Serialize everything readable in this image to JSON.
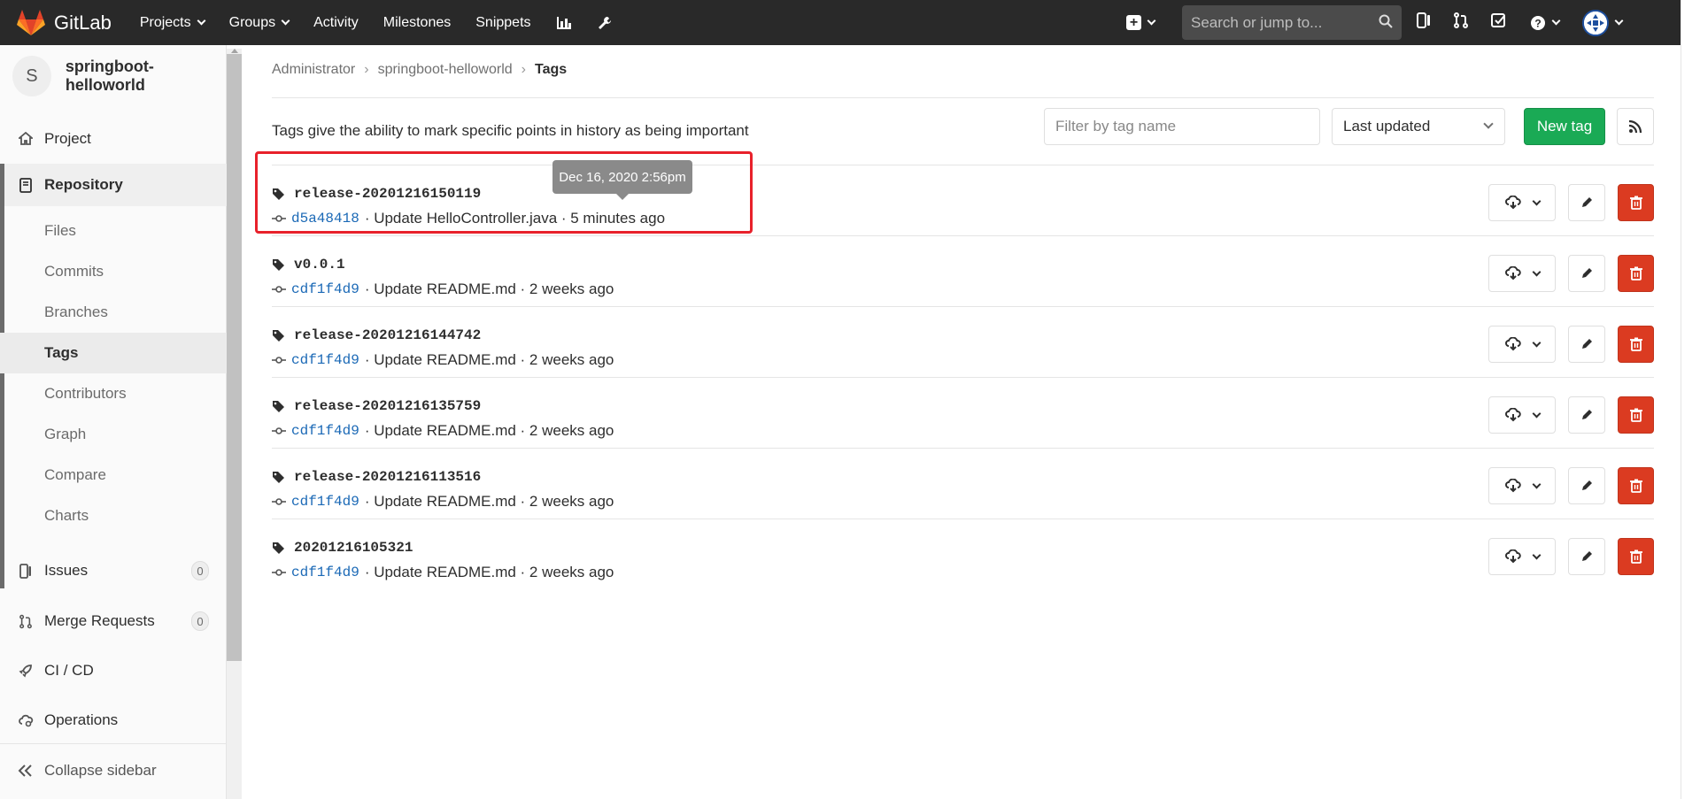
{
  "navbar": {
    "brand": "GitLab",
    "links": [
      {
        "label": "Projects",
        "dropdown": true
      },
      {
        "label": "Groups",
        "dropdown": true
      },
      {
        "label": "Activity",
        "dropdown": false
      },
      {
        "label": "Milestones",
        "dropdown": false
      },
      {
        "label": "Snippets",
        "dropdown": false
      }
    ],
    "search_placeholder": "Search or jump to...",
    "bg_color": "#292929"
  },
  "sidebar": {
    "project_initial": "S",
    "project_name": "springboot-helloworld",
    "project_label": "Project",
    "repository_label": "Repository",
    "sub_items": [
      "Files",
      "Commits",
      "Branches",
      "Tags",
      "Contributors",
      "Graph",
      "Compare",
      "Charts"
    ],
    "active_sub": "Tags",
    "issues_label": "Issues",
    "issues_count": "0",
    "mr_label": "Merge Requests",
    "mr_count": "0",
    "cicd_label": "CI / CD",
    "operations_label": "Operations",
    "collapse_label": "Collapse sidebar"
  },
  "breadcrumb": {
    "items": [
      "Administrator",
      "springboot-helloworld",
      "Tags"
    ]
  },
  "page": {
    "description": "Tags give the ability to mark specific points in history as being important",
    "filter_placeholder": "Filter by tag name",
    "sort_label": "Last updated",
    "new_tag_label": "New tag"
  },
  "tags": [
    {
      "name": "release-20201216150119",
      "sha": "d5a48418",
      "message": "· Update HelloController.java · 5 minutes ago"
    },
    {
      "name": "v0.0.1",
      "sha": "cdf1f4d9",
      "message": "· Update README.md · 2 weeks ago"
    },
    {
      "name": "release-20201216144742",
      "sha": "cdf1f4d9",
      "message": "· Update README.md · 2 weeks ago"
    },
    {
      "name": "release-20201216135759",
      "sha": "cdf1f4d9",
      "message": "· Update README.md · 2 weeks ago"
    },
    {
      "name": "release-20201216113516",
      "sha": "cdf1f4d9",
      "message": "· Update README.md · 2 weeks ago"
    },
    {
      "name": "20201216105321",
      "sha": "cdf1f4d9",
      "message": "· Update README.md · 2 weeks ago"
    }
  ],
  "tooltip": "Dec 16, 2020 2:56pm",
  "colors": {
    "accent_green": "#1aaa55",
    "danger_red": "#db3b21",
    "link_blue": "#1b69b6",
    "highlight_red": "#e8212b"
  }
}
